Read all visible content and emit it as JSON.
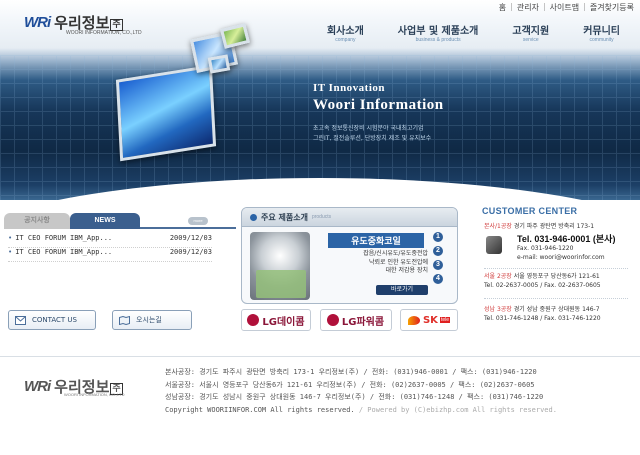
{
  "header": {
    "logo_mark": "WRi",
    "logo_ko": "우리정보",
    "logo_badge": "주",
    "logo_en": "WOORI INFORMATION, CO.,LTD",
    "util_links": [
      "홈",
      "관리자",
      "사이트맵",
      "즐겨찾기등록"
    ],
    "gnb": [
      {
        "ko": "회사소개",
        "en": "company"
      },
      {
        "ko": "사업부 및 제품소개",
        "en": "business & products"
      },
      {
        "ko": "고객지원",
        "en": "service"
      },
      {
        "ko": "커뮤니티",
        "en": "community"
      }
    ],
    "tagline_1": "IT Innovation",
    "tagline_2": "Woori Information",
    "tagline_desc_1": "초고속 정보통신장비 시험분야 국내최고기업",
    "tagline_desc_2": "그린IT, 절전솔루션, 단방장치 제조 및 유지보수"
  },
  "board": {
    "tab_notice": "공지사항",
    "tab_news": "NEWS",
    "more": "more",
    "items": [
      {
        "title": "IT CEO FORUM IBM_App...",
        "date": "2009/12/03"
      },
      {
        "title": "IT CEO FORUM IBM_App...",
        "date": "2009/12/03"
      }
    ]
  },
  "buttons": {
    "contact": "CONTACT US",
    "map": "오시는길"
  },
  "products": {
    "title": "주요 제품소개",
    "title_en": "products",
    "name": "유도중화코일",
    "desc_1": "잡음/신시유도/유도중전압",
    "desc_2": "낙뢰로 인한 유도전압에",
    "desc_3": "대한 저감용 장치",
    "more": "바로가기",
    "nums": [
      "1",
      "2",
      "3",
      "4"
    ]
  },
  "clients": {
    "lg1": "LG데이콤",
    "lg2": "LG파워콤",
    "sk": "SK",
    "sk_sub": "tele"
  },
  "customer": {
    "title": "CUSTOMER CENTER",
    "hq_label": "본사/1공장",
    "hq_addr": "경기 파주 광탄면 방축리 173-1",
    "tel": "Tel. 031-946-0001 (본사)",
    "fax": "Fax. 031-946-1220",
    "email": "e-mail: woori@woorinfor.com",
    "seoul_label": "서울 2공장",
    "seoul_addr": "서울 영등포구 당산동6가 121-61",
    "seoul_tel": "Tel. 02-2637-0005 / Fax. 02-2637-0605",
    "sn_label": "성남 3공장",
    "sn_addr": "경기 성남 중원구 상대원동 146-7",
    "sn_tel": "Tel. 031-746-1248 / Fax. 031-746-1220"
  },
  "footer": {
    "line1": "본사공장: 경기도 파주시 광탄면 방축리 173-1 우리정보(주) / 전화: (031)946-0001 / 팩스: (031)946-1220",
    "line2": "서울공장: 서울시 영등포구 당산동6가 121-61 우리정보(주) / 전화: (02)2637-0005 / 팩스: (02)2637-0605",
    "line3": "성남공장: 경기도 성남시 중원구 상대원동 146-7 우리정보(주) / 전화: (031)746-1248 / 팩스: (031)746-1220",
    "copyright": "Copyright WOORIINFOR.COM All rights reserved.",
    "powered": "/ Powered by (C)ebizhp.com All rights reserved."
  }
}
